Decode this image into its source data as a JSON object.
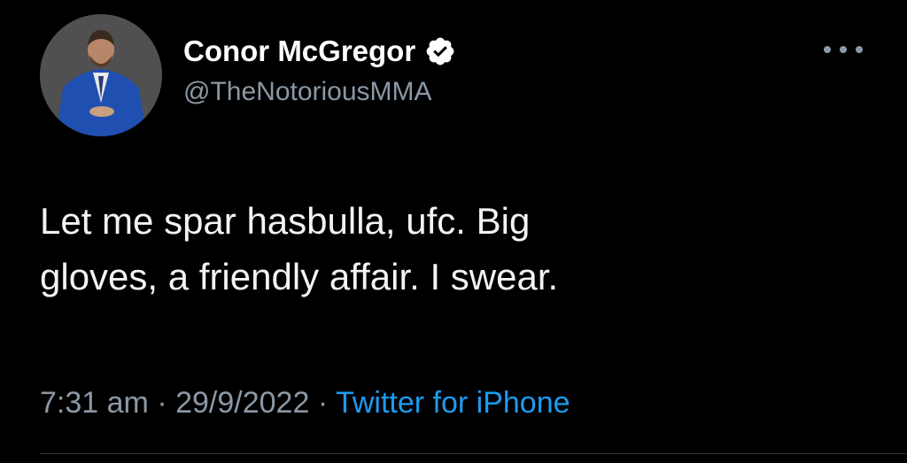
{
  "tweet": {
    "author": {
      "display_name": "Conor McGregor",
      "handle": "@TheNotoriousMMA",
      "verified": true,
      "avatar_icon": "profile-photo"
    },
    "text": "Let me spar hasbulla, ufc. Big\ngloves, a friendly affair. I swear.",
    "time": "7:31 am",
    "separator": "·",
    "date": "29/9/2022",
    "source": "Twitter for iPhone"
  },
  "colors": {
    "background": "#000000",
    "name": "#ffffff",
    "secondary": "#8b98a5",
    "link": "#1d9bf0",
    "verified_badge": "#ffffff"
  },
  "icons": {
    "more": "more-horizontal-icon",
    "verified": "verified-badge-icon"
  }
}
